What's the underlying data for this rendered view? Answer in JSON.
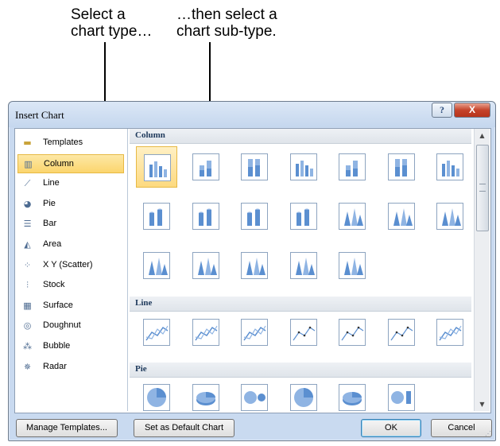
{
  "callouts": {
    "left_line1": "Select a",
    "left_line2": "chart type…",
    "right_line1": "…then select a",
    "right_line2": "chart sub-type."
  },
  "dialog": {
    "title": "Insert Chart",
    "help_glyph": "?",
    "close_glyph": "X"
  },
  "chart_types": [
    {
      "label": "Templates",
      "icon": "folder-icon"
    },
    {
      "label": "Column",
      "icon": "column-chart-icon"
    },
    {
      "label": "Line",
      "icon": "line-chart-icon"
    },
    {
      "label": "Pie",
      "icon": "pie-chart-icon"
    },
    {
      "label": "Bar",
      "icon": "bar-chart-icon"
    },
    {
      "label": "Area",
      "icon": "area-chart-icon"
    },
    {
      "label": "X Y (Scatter)",
      "icon": "scatter-chart-icon"
    },
    {
      "label": "Stock",
      "icon": "stock-chart-icon"
    },
    {
      "label": "Surface",
      "icon": "surface-chart-icon"
    },
    {
      "label": "Doughnut",
      "icon": "doughnut-chart-icon"
    },
    {
      "label": "Bubble",
      "icon": "bubble-chart-icon"
    },
    {
      "label": "Radar",
      "icon": "radar-chart-icon"
    }
  ],
  "selected_type": "Column",
  "sections": {
    "column": "Column",
    "line": "Line",
    "pie": "Pie"
  },
  "buttons": {
    "manage_templates": "Manage Templates...",
    "set_default": "Set as Default Chart",
    "ok": "OK",
    "cancel": "Cancel"
  },
  "accent": {
    "selection": "#fbd56d",
    "chart_blue": "#5b8fd0"
  }
}
